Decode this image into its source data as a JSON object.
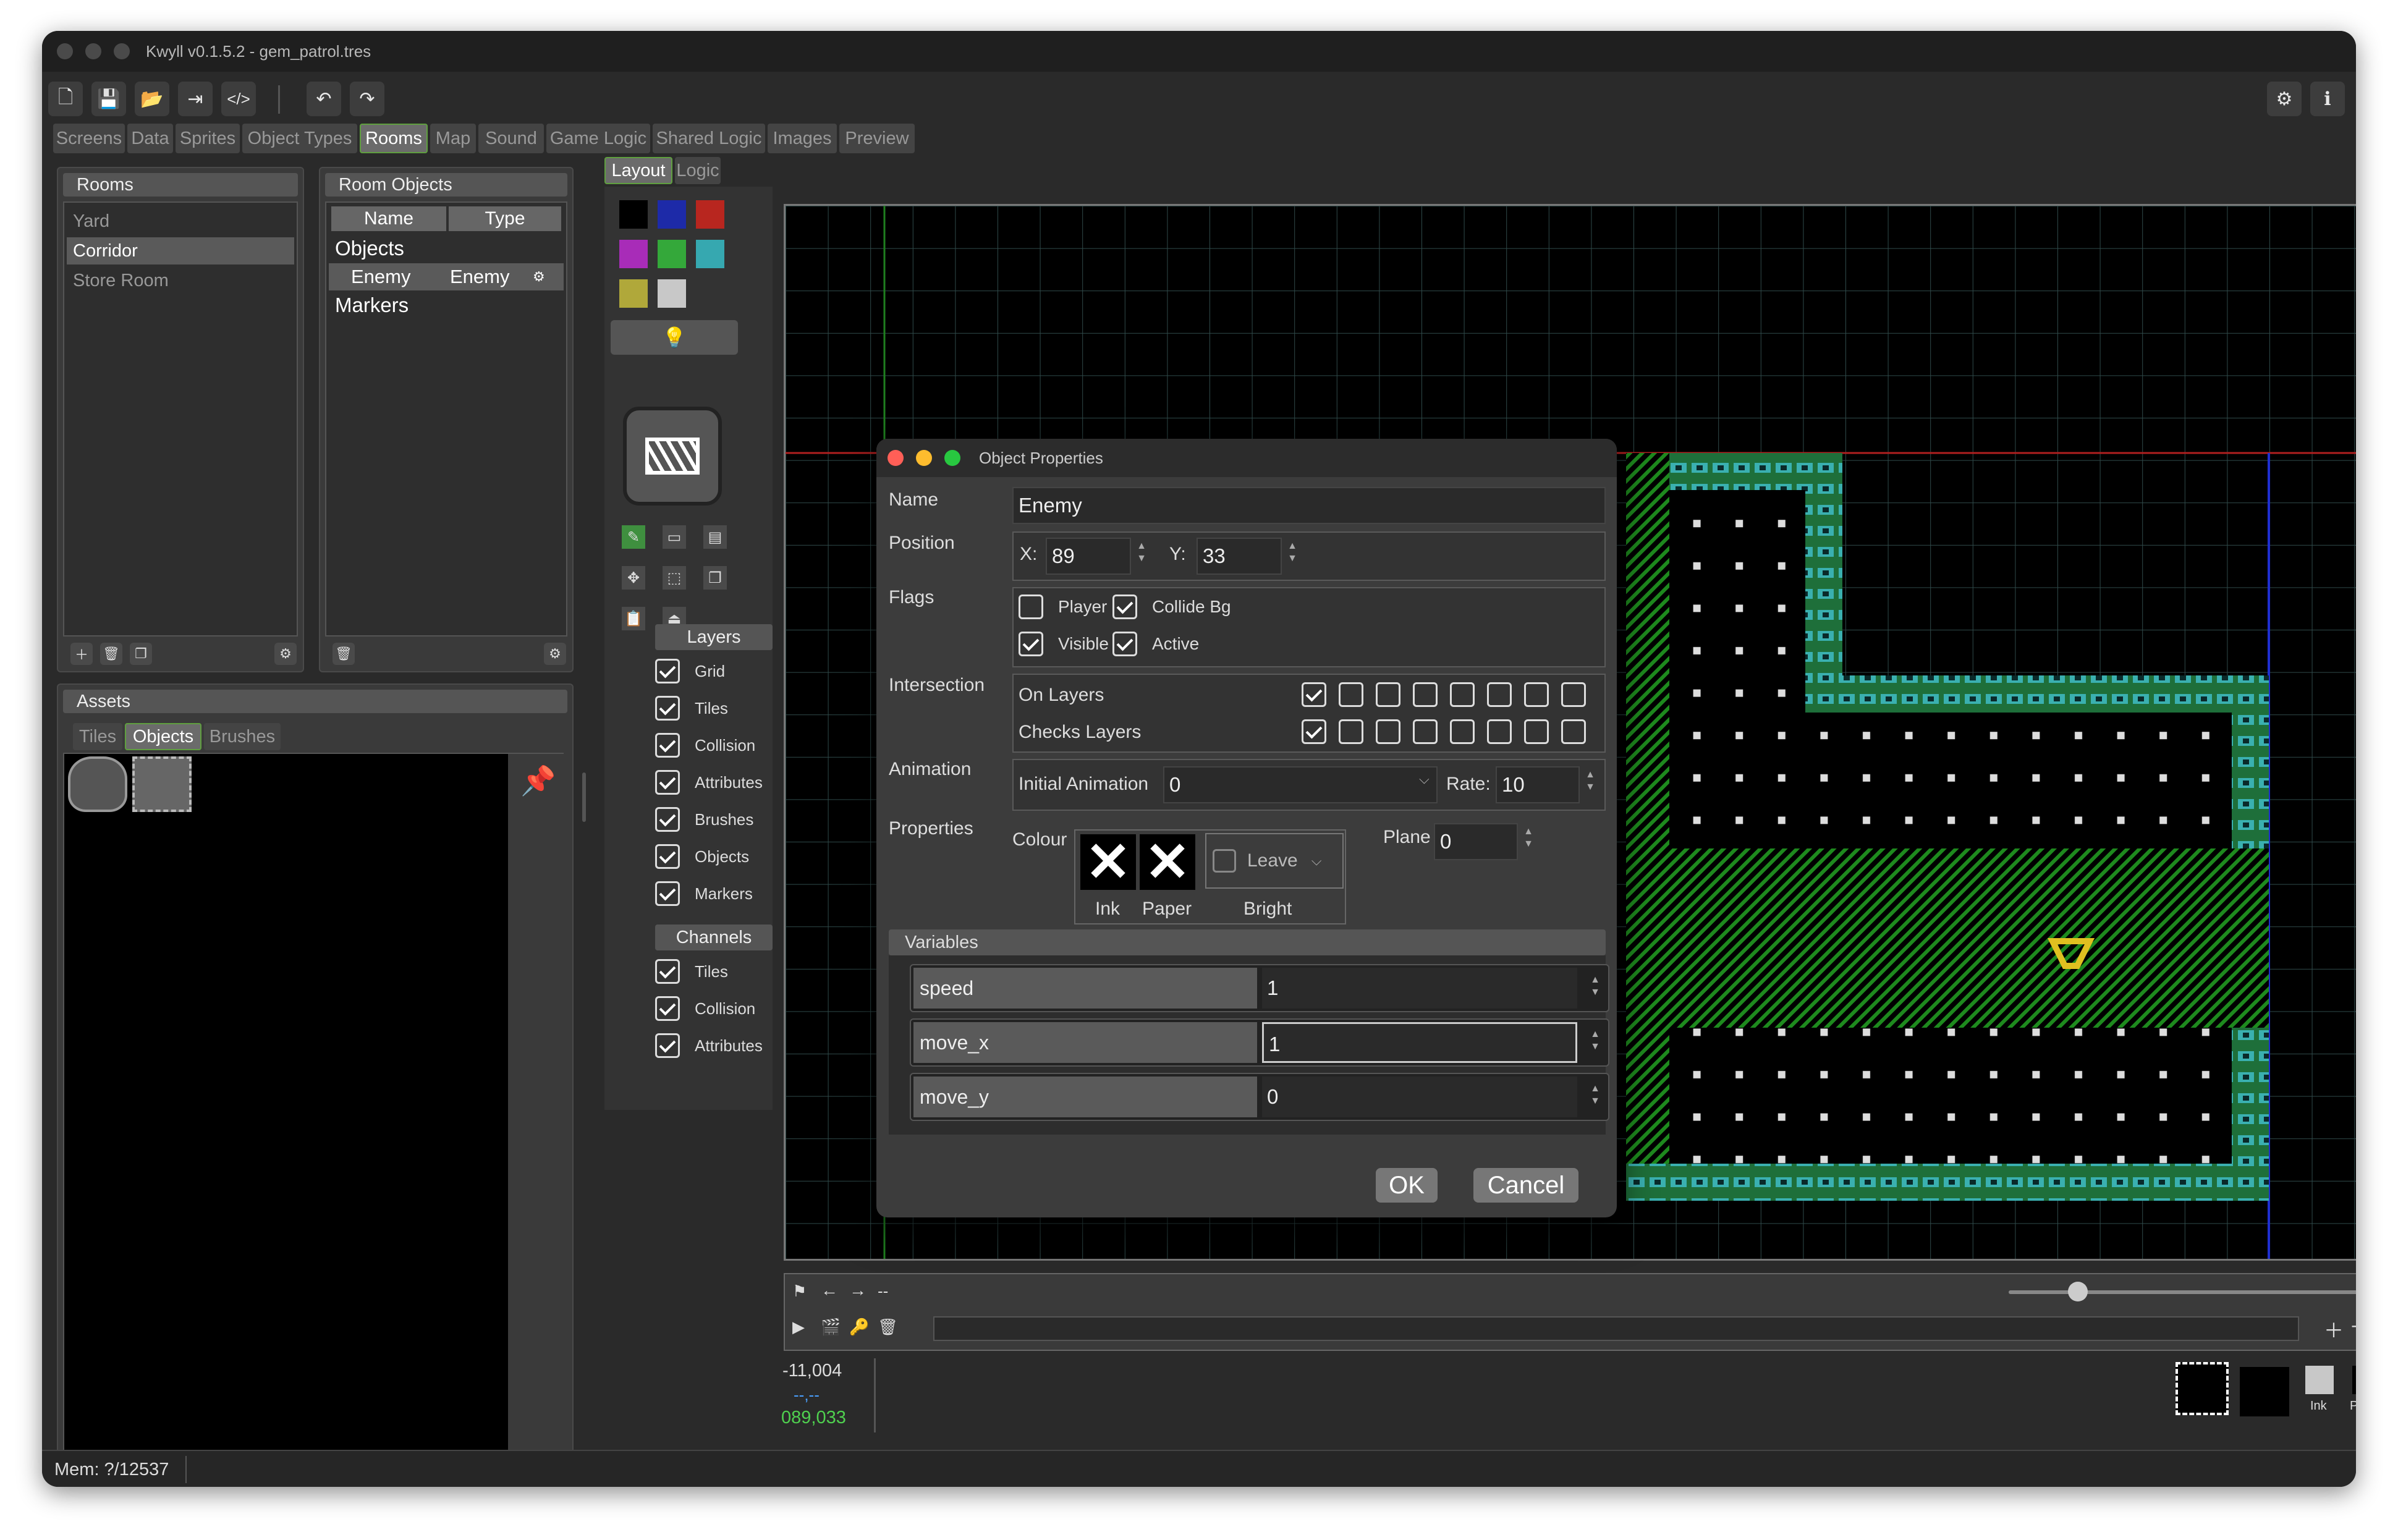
{
  "window": {
    "title": "Kwyll v0.1.5.2 - gem_patrol.tres"
  },
  "tabs": [
    "Screens",
    "Data",
    "Sprites",
    "Object Types",
    "Rooms",
    "Map",
    "Sound",
    "Game Logic",
    "Shared Logic",
    "Images",
    "Preview"
  ],
  "active_tab": "Rooms",
  "rooms": {
    "header": "Rooms",
    "items": [
      "Yard",
      "Corridor",
      "Store Room"
    ],
    "selected": "Corridor"
  },
  "room_objects": {
    "header": "Room Objects",
    "col_name": "Name",
    "col_type": "Type",
    "group_objects": "Objects",
    "object_name": "Enemy",
    "object_type": "Enemy",
    "group_markers": "Markers"
  },
  "assets": {
    "header": "Assets",
    "tabs": [
      "Tiles",
      "Objects",
      "Brushes"
    ],
    "active": "Objects"
  },
  "subtabs": [
    "Layout",
    "Logic"
  ],
  "layers": {
    "header": "Layers",
    "items": [
      "Grid",
      "Tiles",
      "Collision",
      "Attributes",
      "Brushes",
      "Objects",
      "Markers"
    ]
  },
  "channels": {
    "header": "Channels",
    "items": [
      "Tiles",
      "Collision",
      "Attributes"
    ]
  },
  "palette": [
    "#000000",
    "#1d2aa8",
    "#b8261f",
    "#a82cb8",
    "#34a83a",
    "#36a8b0",
    "#b0a83a",
    "#c8c8c8"
  ],
  "dialog": {
    "title": "Object Properties",
    "name_label": "Name",
    "name_value": "Enemy",
    "position_label": "Position",
    "x_label": "X:",
    "x_value": "89",
    "y_label": "Y:",
    "y_value": "33",
    "flags_label": "Flags",
    "flag_player": "Player",
    "flag_collide": "Collide Bg",
    "flag_visible": "Visible",
    "flag_active": "Active",
    "intersection_label": "Intersection",
    "on_layers": "On Layers",
    "checks_layers": "Checks Layers",
    "animation_label": "Animation",
    "initial_animation": "Initial Animation",
    "animation_value": "0",
    "rate_label": "Rate:",
    "rate_value": "10",
    "properties_label": "Properties",
    "colour_label": "Colour",
    "ink_label": "Ink",
    "paper_label": "Paper",
    "bright_label": "Bright",
    "leave_label": "Leave",
    "plane_label": "Plane",
    "plane_value": "0",
    "variables_header": "Variables",
    "variables": [
      {
        "key": "speed",
        "value": "1"
      },
      {
        "key": "move_x",
        "value": "1"
      },
      {
        "key": "move_y",
        "value": "0"
      }
    ],
    "ok": "OK",
    "cancel": "Cancel"
  },
  "timeline": {
    "label": "--"
  },
  "coords": {
    "cursor": "-11,004",
    "second": "--,--",
    "third": "089,033"
  },
  "swatch_labels": {
    "ink": "Ink",
    "paper": "Paper"
  },
  "status": {
    "mem": "Mem: ?/12537"
  }
}
